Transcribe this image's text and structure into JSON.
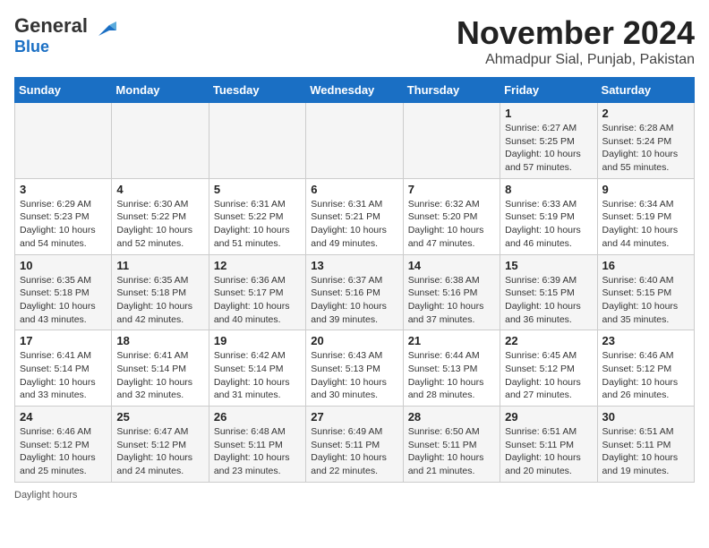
{
  "header": {
    "logo_general": "General",
    "logo_blue": "Blue",
    "month_title": "November 2024",
    "location": "Ahmadpur Sial, Punjab, Pakistan"
  },
  "days_of_week": [
    "Sunday",
    "Monday",
    "Tuesday",
    "Wednesday",
    "Thursday",
    "Friday",
    "Saturday"
  ],
  "weeks": [
    [
      {
        "day": "",
        "info": ""
      },
      {
        "day": "",
        "info": ""
      },
      {
        "day": "",
        "info": ""
      },
      {
        "day": "",
        "info": ""
      },
      {
        "day": "",
        "info": ""
      },
      {
        "day": "1",
        "info": "Sunrise: 6:27 AM\nSunset: 5:25 PM\nDaylight: 10 hours and 57 minutes."
      },
      {
        "day": "2",
        "info": "Sunrise: 6:28 AM\nSunset: 5:24 PM\nDaylight: 10 hours and 55 minutes."
      }
    ],
    [
      {
        "day": "3",
        "info": "Sunrise: 6:29 AM\nSunset: 5:23 PM\nDaylight: 10 hours and 54 minutes."
      },
      {
        "day": "4",
        "info": "Sunrise: 6:30 AM\nSunset: 5:22 PM\nDaylight: 10 hours and 52 minutes."
      },
      {
        "day": "5",
        "info": "Sunrise: 6:31 AM\nSunset: 5:22 PM\nDaylight: 10 hours and 51 minutes."
      },
      {
        "day": "6",
        "info": "Sunrise: 6:31 AM\nSunset: 5:21 PM\nDaylight: 10 hours and 49 minutes."
      },
      {
        "day": "7",
        "info": "Sunrise: 6:32 AM\nSunset: 5:20 PM\nDaylight: 10 hours and 47 minutes."
      },
      {
        "day": "8",
        "info": "Sunrise: 6:33 AM\nSunset: 5:19 PM\nDaylight: 10 hours and 46 minutes."
      },
      {
        "day": "9",
        "info": "Sunrise: 6:34 AM\nSunset: 5:19 PM\nDaylight: 10 hours and 44 minutes."
      }
    ],
    [
      {
        "day": "10",
        "info": "Sunrise: 6:35 AM\nSunset: 5:18 PM\nDaylight: 10 hours and 43 minutes."
      },
      {
        "day": "11",
        "info": "Sunrise: 6:35 AM\nSunset: 5:18 PM\nDaylight: 10 hours and 42 minutes."
      },
      {
        "day": "12",
        "info": "Sunrise: 6:36 AM\nSunset: 5:17 PM\nDaylight: 10 hours and 40 minutes."
      },
      {
        "day": "13",
        "info": "Sunrise: 6:37 AM\nSunset: 5:16 PM\nDaylight: 10 hours and 39 minutes."
      },
      {
        "day": "14",
        "info": "Sunrise: 6:38 AM\nSunset: 5:16 PM\nDaylight: 10 hours and 37 minutes."
      },
      {
        "day": "15",
        "info": "Sunrise: 6:39 AM\nSunset: 5:15 PM\nDaylight: 10 hours and 36 minutes."
      },
      {
        "day": "16",
        "info": "Sunrise: 6:40 AM\nSunset: 5:15 PM\nDaylight: 10 hours and 35 minutes."
      }
    ],
    [
      {
        "day": "17",
        "info": "Sunrise: 6:41 AM\nSunset: 5:14 PM\nDaylight: 10 hours and 33 minutes."
      },
      {
        "day": "18",
        "info": "Sunrise: 6:41 AM\nSunset: 5:14 PM\nDaylight: 10 hours and 32 minutes."
      },
      {
        "day": "19",
        "info": "Sunrise: 6:42 AM\nSunset: 5:14 PM\nDaylight: 10 hours and 31 minutes."
      },
      {
        "day": "20",
        "info": "Sunrise: 6:43 AM\nSunset: 5:13 PM\nDaylight: 10 hours and 30 minutes."
      },
      {
        "day": "21",
        "info": "Sunrise: 6:44 AM\nSunset: 5:13 PM\nDaylight: 10 hours and 28 minutes."
      },
      {
        "day": "22",
        "info": "Sunrise: 6:45 AM\nSunset: 5:12 PM\nDaylight: 10 hours and 27 minutes."
      },
      {
        "day": "23",
        "info": "Sunrise: 6:46 AM\nSunset: 5:12 PM\nDaylight: 10 hours and 26 minutes."
      }
    ],
    [
      {
        "day": "24",
        "info": "Sunrise: 6:46 AM\nSunset: 5:12 PM\nDaylight: 10 hours and 25 minutes."
      },
      {
        "day": "25",
        "info": "Sunrise: 6:47 AM\nSunset: 5:12 PM\nDaylight: 10 hours and 24 minutes."
      },
      {
        "day": "26",
        "info": "Sunrise: 6:48 AM\nSunset: 5:11 PM\nDaylight: 10 hours and 23 minutes."
      },
      {
        "day": "27",
        "info": "Sunrise: 6:49 AM\nSunset: 5:11 PM\nDaylight: 10 hours and 22 minutes."
      },
      {
        "day": "28",
        "info": "Sunrise: 6:50 AM\nSunset: 5:11 PM\nDaylight: 10 hours and 21 minutes."
      },
      {
        "day": "29",
        "info": "Sunrise: 6:51 AM\nSunset: 5:11 PM\nDaylight: 10 hours and 20 minutes."
      },
      {
        "day": "30",
        "info": "Sunrise: 6:51 AM\nSunset: 5:11 PM\nDaylight: 10 hours and 19 minutes."
      }
    ]
  ],
  "footer": {
    "daylight_label": "Daylight hours"
  }
}
